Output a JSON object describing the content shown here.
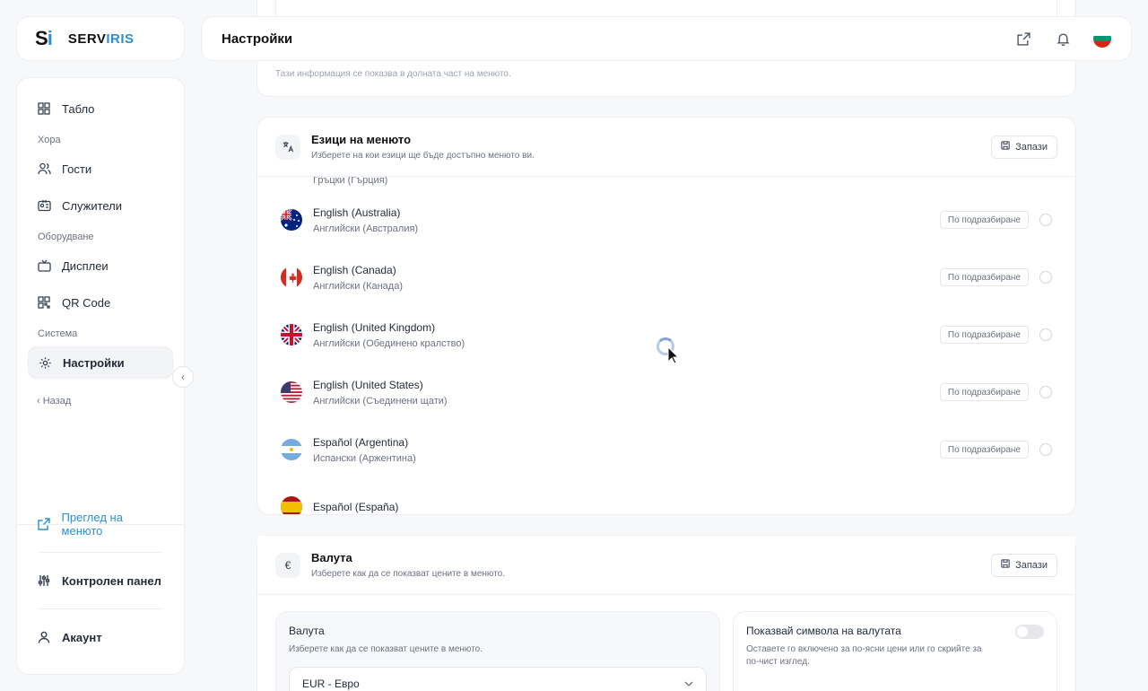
{
  "logo": {
    "mark_a": "S",
    "mark_b": "i",
    "text_a": "SERV",
    "text_b": "IRIS"
  },
  "header": {
    "title": "Настройки"
  },
  "sidebar": {
    "items": [
      {
        "label": "Табло",
        "icon": "grid-icon"
      },
      {
        "section": "Хора"
      },
      {
        "label": "Гости",
        "icon": "users-icon"
      },
      {
        "label": "Служители",
        "icon": "id-card-icon"
      },
      {
        "section": "Оборудване"
      },
      {
        "label": "Дисплеи",
        "icon": "tv-icon"
      },
      {
        "label": "QR Code",
        "icon": "qr-icon"
      },
      {
        "section": "Система"
      },
      {
        "label": "Настройки",
        "icon": "gear-icon",
        "active": true
      }
    ],
    "back_label": "Назад",
    "bottom": {
      "preview_label": "Преглед на менюто",
      "dashboard_label": "Контролен панел",
      "account_label": "Акаунт"
    }
  },
  "top_card": {
    "note": "Тази информация се показва в долната част на менюто."
  },
  "languages": {
    "title": "Езици на менюто",
    "subtitle": "Изберете на кои езици ще бъде достъпно менюто ви.",
    "save_label": "Запази",
    "default_label": "По подразбиране",
    "rows": [
      {
        "name": "",
        "native": "Гръцки (Гърция)",
        "flag": "gr"
      },
      {
        "name": "English (Australia)",
        "native": "Английски (Австралия)",
        "flag": "au"
      },
      {
        "name": "English (Canada)",
        "native": "Английски (Канада)",
        "flag": "ca"
      },
      {
        "name": "English (United Kingdom)",
        "native": "Английски (Обединено кралство)",
        "flag": "gb"
      },
      {
        "name": "English (United States)",
        "native": "Английски (Съединени щати)",
        "flag": "us"
      },
      {
        "name": "Español (Argentina)",
        "native": "Испански (Аржентина)",
        "flag": "ar"
      },
      {
        "name": "Español (España)",
        "native": "",
        "flag": "es"
      }
    ]
  },
  "currency": {
    "icon": "€",
    "title": "Валута",
    "subtitle": "Изберете как да се показват цените в менюто.",
    "save_label": "Запази",
    "left": {
      "title": "Валута",
      "desc": "Изберете как да се показват цените в менюто.",
      "selected": "EUR - Евро"
    },
    "right": {
      "title": "Показвай символа на валутата",
      "desc": "Оставете го включено за по-ясни цени или го скрийте за по-чист изглед.",
      "toggle_on": false
    }
  },
  "colors": {
    "accent": "#2b8fd6",
    "border": "#eceef2"
  }
}
